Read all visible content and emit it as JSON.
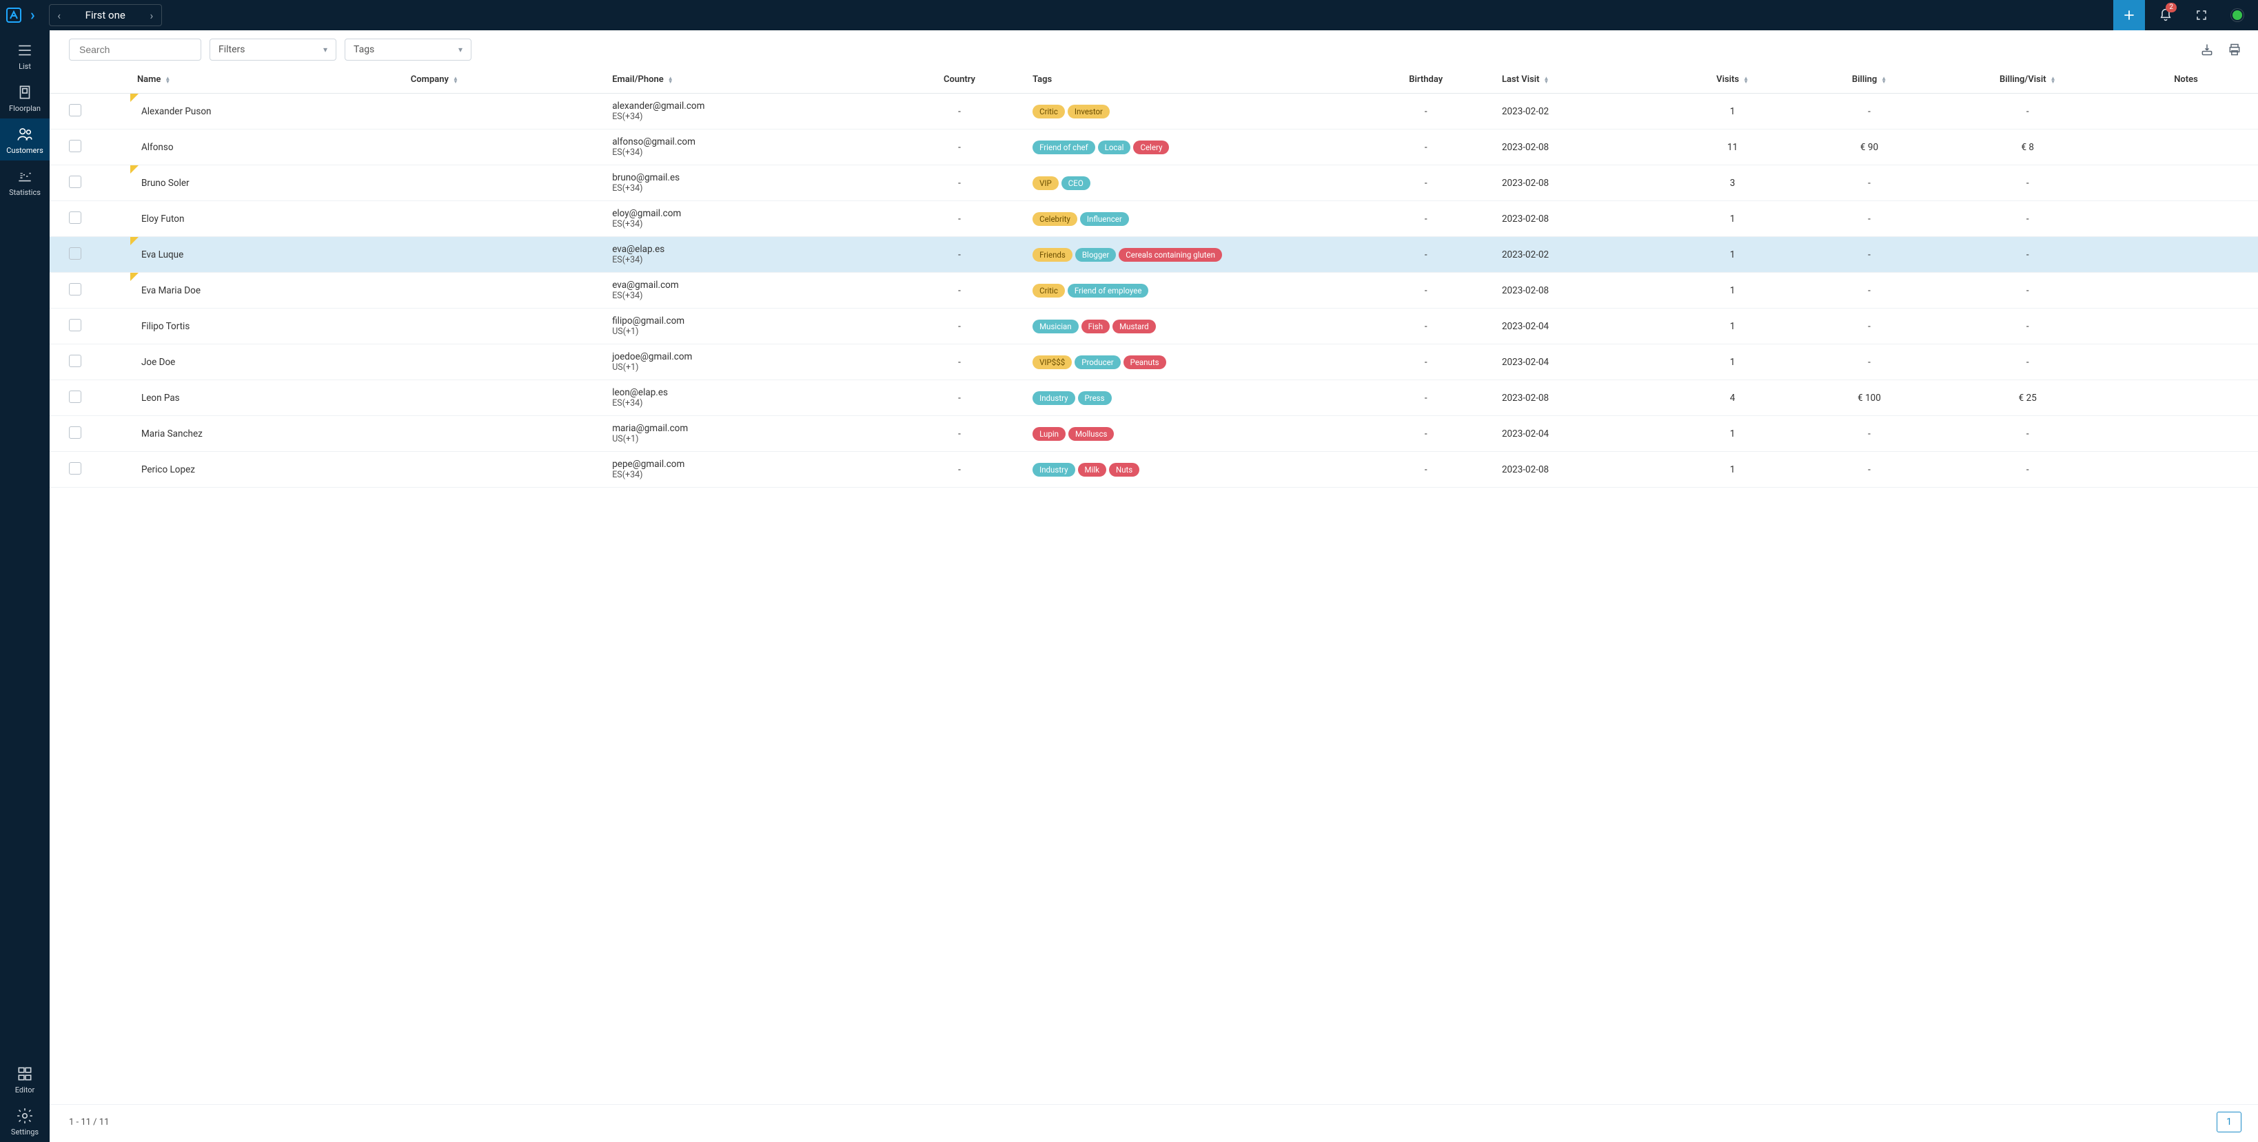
{
  "topbar": {
    "title": "First one",
    "notif_badge": "2"
  },
  "sidebar": {
    "items": [
      {
        "label": "List"
      },
      {
        "label": "Floorplan"
      },
      {
        "label": "Customers"
      },
      {
        "label": "Statistics"
      }
    ],
    "bottom": [
      {
        "label": "Editor"
      },
      {
        "label": "Settings"
      }
    ]
  },
  "toolbar": {
    "search_placeholder": "Search",
    "filters_label": "Filters",
    "tags_label": "Tags"
  },
  "columns": {
    "name": "Name",
    "company": "Company",
    "email": "Email/Phone",
    "country": "Country",
    "tags": "Tags",
    "birthday": "Birthday",
    "last_visit": "Last Visit",
    "visits": "Visits",
    "billing": "Billing",
    "billing_visit": "Billing/Visit",
    "notes": "Notes"
  },
  "rows": [
    {
      "flag": true,
      "name": "Alexander Puson",
      "company": "",
      "email": "alexander@gmail.com",
      "phone": "ES(+34)",
      "country": "-",
      "tags": [
        {
          "text": "Critic",
          "c": "yellow"
        },
        {
          "text": "Investor",
          "c": "yellow"
        }
      ],
      "birthday": "-",
      "last_visit": "2023-02-02",
      "visits": "1",
      "billing": "-",
      "billing_visit": "-",
      "notes": "",
      "hl": false
    },
    {
      "flag": false,
      "name": "Alfonso",
      "company": "",
      "email": "alfonso@gmail.com",
      "phone": "ES(+34)",
      "country": "-",
      "tags": [
        {
          "text": "Friend of chef",
          "c": "teal"
        },
        {
          "text": "Local",
          "c": "teal"
        },
        {
          "text": "Celery",
          "c": "red"
        }
      ],
      "birthday": "-",
      "last_visit": "2023-02-08",
      "visits": "11",
      "billing": "€ 90",
      "billing_visit": "€ 8",
      "notes": "",
      "hl": false
    },
    {
      "flag": true,
      "name": "Bruno Soler",
      "company": "",
      "email": "bruno@gmail.es",
      "phone": "ES(+34)",
      "country": "-",
      "tags": [
        {
          "text": "VIP",
          "c": "yellow"
        },
        {
          "text": "CEO",
          "c": "teal"
        }
      ],
      "birthday": "-",
      "last_visit": "2023-02-08",
      "visits": "3",
      "billing": "-",
      "billing_visit": "-",
      "notes": "",
      "hl": false
    },
    {
      "flag": false,
      "name": "Eloy Futon",
      "company": "",
      "email": "eloy@gmail.com",
      "phone": "ES(+34)",
      "country": "-",
      "tags": [
        {
          "text": "Celebrity",
          "c": "yellow"
        },
        {
          "text": "Influencer",
          "c": "teal"
        }
      ],
      "birthday": "-",
      "last_visit": "2023-02-08",
      "visits": "1",
      "billing": "-",
      "billing_visit": "-",
      "notes": "",
      "hl": false
    },
    {
      "flag": true,
      "name": "Eva Luque",
      "company": "",
      "email": "eva@elap.es",
      "phone": "ES(+34)",
      "country": "-",
      "tags": [
        {
          "text": "Friends",
          "c": "yellow"
        },
        {
          "text": "Blogger",
          "c": "teal"
        },
        {
          "text": "Cereals containing gluten",
          "c": "red"
        }
      ],
      "birthday": "-",
      "last_visit": "2023-02-02",
      "visits": "1",
      "billing": "-",
      "billing_visit": "-",
      "notes": "",
      "hl": true
    },
    {
      "flag": true,
      "name": "Eva Maria Doe",
      "company": "",
      "email": "eva@gmail.com",
      "phone": "ES(+34)",
      "country": "-",
      "tags": [
        {
          "text": "Critic",
          "c": "yellow"
        },
        {
          "text": "Friend of employee",
          "c": "teal"
        }
      ],
      "birthday": "-",
      "last_visit": "2023-02-08",
      "visits": "1",
      "billing": "-",
      "billing_visit": "-",
      "notes": "",
      "hl": false
    },
    {
      "flag": false,
      "name": "Filipo Tortis",
      "company": "",
      "email": "filipo@gmail.com",
      "phone": "US(+1)",
      "country": "-",
      "tags": [
        {
          "text": "Musician",
          "c": "teal"
        },
        {
          "text": "Fish",
          "c": "red"
        },
        {
          "text": "Mustard",
          "c": "red"
        }
      ],
      "birthday": "-",
      "last_visit": "2023-02-04",
      "visits": "1",
      "billing": "-",
      "billing_visit": "-",
      "notes": "",
      "hl": false
    },
    {
      "flag": false,
      "name": "Joe Doe",
      "company": "",
      "email": "joedoe@gmail.com",
      "phone": "US(+1)",
      "country": "-",
      "tags": [
        {
          "text": "VIP$$$",
          "c": "yellow"
        },
        {
          "text": "Producer",
          "c": "teal"
        },
        {
          "text": "Peanuts",
          "c": "red"
        }
      ],
      "birthday": "-",
      "last_visit": "2023-02-04",
      "visits": "1",
      "billing": "-",
      "billing_visit": "-",
      "notes": "",
      "hl": false
    },
    {
      "flag": false,
      "name": "Leon Pas",
      "company": "",
      "email": "leon@elap.es",
      "phone": "ES(+34)",
      "country": "-",
      "tags": [
        {
          "text": "Industry",
          "c": "teal"
        },
        {
          "text": "Press",
          "c": "teal"
        }
      ],
      "birthday": "-",
      "last_visit": "2023-02-08",
      "visits": "4",
      "billing": "€ 100",
      "billing_visit": "€ 25",
      "notes": "",
      "hl": false
    },
    {
      "flag": false,
      "name": "Maria Sanchez",
      "company": "",
      "email": "maria@gmail.com",
      "phone": "US(+1)",
      "country": "-",
      "tags": [
        {
          "text": "Lupin",
          "c": "red"
        },
        {
          "text": "Molluscs",
          "c": "red"
        }
      ],
      "birthday": "-",
      "last_visit": "2023-02-04",
      "visits": "1",
      "billing": "-",
      "billing_visit": "-",
      "notes": "",
      "hl": false
    },
    {
      "flag": false,
      "name": "Perico Lopez",
      "company": "",
      "email": "pepe@gmail.com",
      "phone": "ES(+34)",
      "country": "-",
      "tags": [
        {
          "text": "Industry",
          "c": "teal"
        },
        {
          "text": "Milk",
          "c": "red"
        },
        {
          "text": "Nuts",
          "c": "red"
        }
      ],
      "birthday": "-",
      "last_visit": "2023-02-08",
      "visits": "1",
      "billing": "-",
      "billing_visit": "-",
      "notes": "",
      "hl": false
    }
  ],
  "footer": {
    "range": "1 - 11 / 11",
    "page": "1"
  }
}
